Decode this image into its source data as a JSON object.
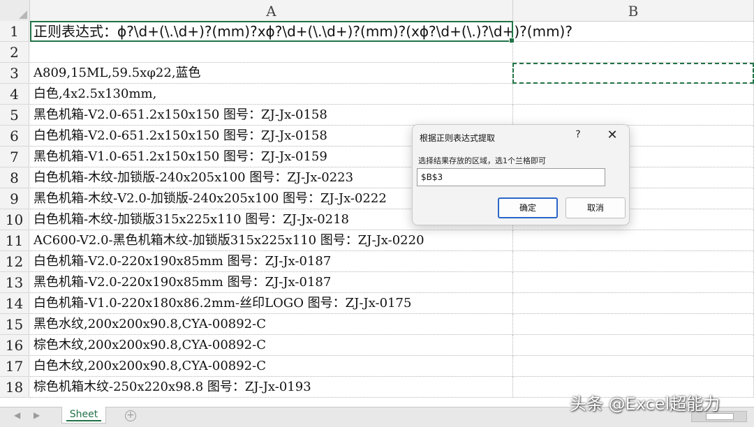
{
  "columns": [
    "A",
    "B"
  ],
  "row_numbers": [
    "1",
    "2",
    "3",
    "4",
    "5",
    "6",
    "7",
    "8",
    "9",
    "10",
    "11",
    "12",
    "13",
    "14",
    "15",
    "16",
    "17",
    "18"
  ],
  "cells": [
    "正则表达式：ϕ?\\d+(\\.\\d+)?(mm)?xϕ?\\d+(\\.\\d+)?(mm)?(xϕ?\\d+(\\.)?\\d+)?(mm)?",
    "",
    "A809,15ML,59.5xφ22,蓝色",
    "白色,4x2.5x130mm,",
    "黑色机箱-V2.0-651.2x150x150 图号：ZJ-Jx-0158",
    "白色机箱-V2.0-651.2x150x150 图号：ZJ-Jx-0158",
    "黑色机箱-V1.0-651.2x150x150 图号：ZJ-Jx-0159",
    "白色机箱-木纹-加锁版-240x205x100 图号：ZJ-Jx-0223",
    "黑色机箱-木纹-V2.0-加锁版-240x205x100 图号：ZJ-Jx-0222",
    "白色机箱-木纹-加锁版315x225x110 图号：ZJ-Jx-0218",
    "AC600-V2.0-黑色机箱木纹-加锁版315x225x110 图号：ZJ-Jx-0220",
    "白色机箱-V2.0-220x190x85mm 图号：ZJ-Jx-0187",
    "黑色机箱-V2.0-220x190x85mm 图号：ZJ-Jx-0187",
    "白色机箱-V1.0-220x180x86.2mm-丝印LOGO 图号：ZJ-Jx-0175",
    "黑色水纹,200x200x90.8,CYA-00892-C",
    "棕色木纹,200x200x90.8,CYA-00892-C",
    "白色木纹,200x200x90.8,CYA-00892-C",
    "棕色机箱木纹-250x220x98.8 图号：ZJ-Jx-0193"
  ],
  "dialog": {
    "title": "根据正则表达式提取",
    "help": "?",
    "close": "✕",
    "label": "选择结果存放的区域，选1个兰格即可",
    "input_value": "$B$3",
    "ok_label": "确定",
    "cancel_label": "取消"
  },
  "sheet_tab": "Sheet",
  "add_sheet": "+",
  "watermark": "头条 @Excel超能力",
  "colors": {
    "accent": "#217346",
    "dialog_ok_border": "#2b66c8"
  }
}
